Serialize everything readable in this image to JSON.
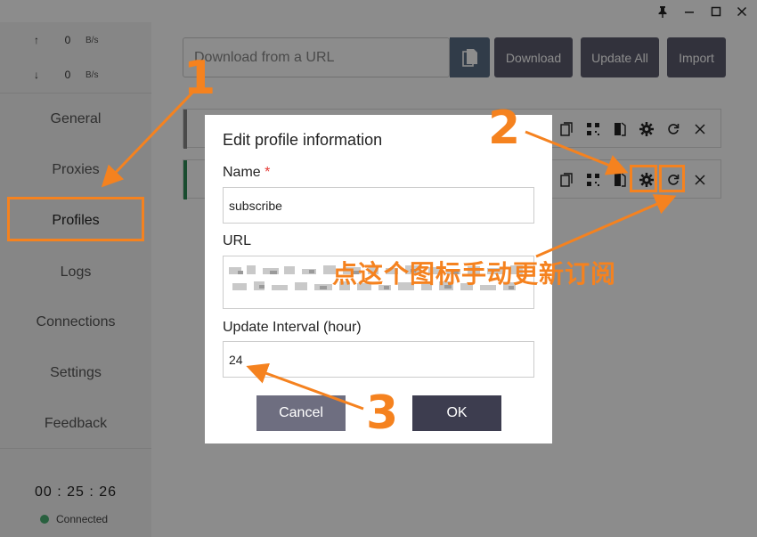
{
  "window": {
    "pin_icon": "pin-icon",
    "minimize_icon": "minimize-icon",
    "maximize_icon": "maximize-icon",
    "close_icon": "close-icon"
  },
  "sidebar": {
    "traffic": {
      "up_arrow": "↑",
      "up_value": "0",
      "up_unit": "B/s",
      "down_arrow": "↓",
      "down_value": "0",
      "down_unit": "B/s"
    },
    "items": [
      {
        "label": "General"
      },
      {
        "label": "Proxies"
      },
      {
        "label": "Profiles"
      },
      {
        "label": "Logs"
      },
      {
        "label": "Connections"
      },
      {
        "label": "Settings"
      },
      {
        "label": "Feedback"
      }
    ],
    "active_item": "Profiles",
    "clock": "00 : 25 : 26",
    "status": "Connected",
    "status_color": "#4caf73"
  },
  "toolbar": {
    "url_placeholder": "Download from a URL",
    "download_label": "Download",
    "update_all_label": "Update All",
    "import_label": "Import"
  },
  "profile_row_icons": [
    "copy-icon",
    "qr-icon",
    "edit-file-icon",
    "gear-icon",
    "refresh-icon",
    "close-icon"
  ],
  "dialog": {
    "title": "Edit profile information",
    "name_label": "Name",
    "required_mark": "*",
    "name_value": "subscribe",
    "url_label": "URL",
    "interval_label": "Update Interval (hour)",
    "interval_value": "24",
    "cancel_label": "Cancel",
    "ok_label": "OK"
  },
  "annotations": {
    "step1": "1",
    "step2": "2",
    "step3": "3",
    "note": "点这个图标手动更新订阅",
    "accent_color": "#f5821f"
  }
}
